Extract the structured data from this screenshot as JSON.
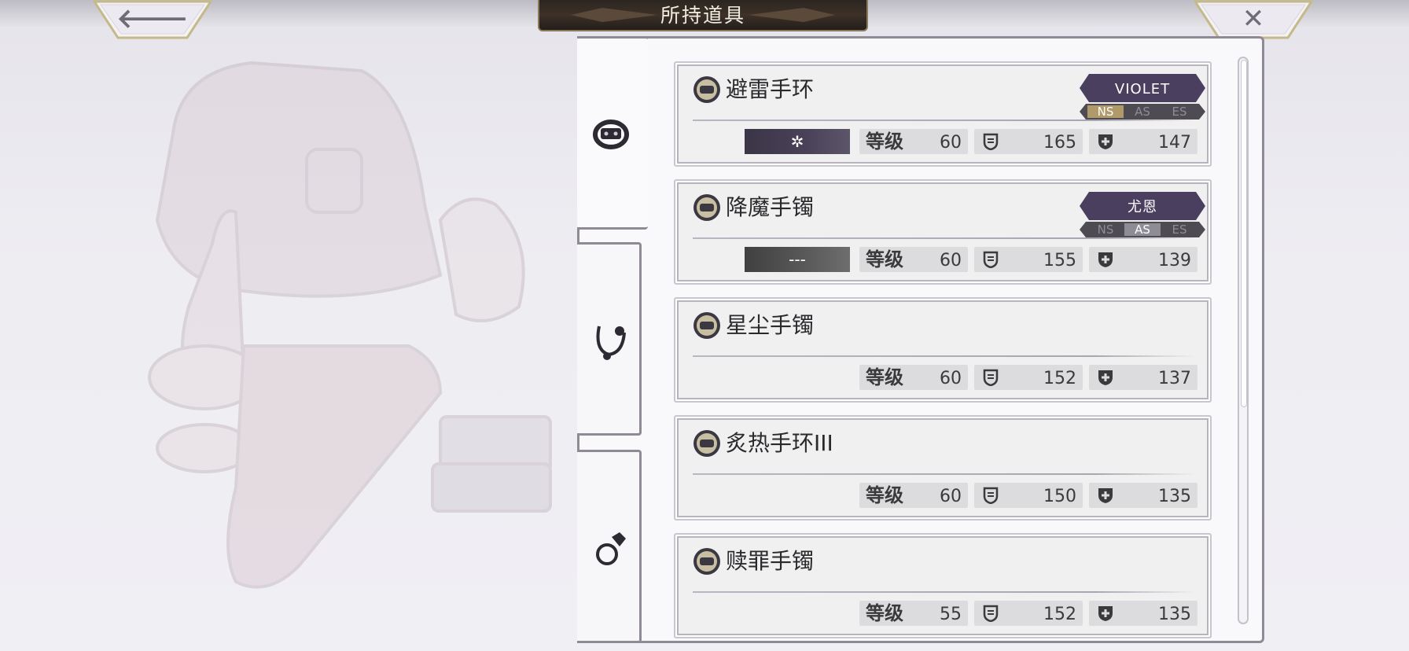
{
  "header": {
    "title": "所持道具",
    "back_icon": "back-arrow-icon",
    "close_icon": "close-icon"
  },
  "tabs": [
    {
      "icon": "bracelet-icon",
      "active": true
    },
    {
      "icon": "necklace-icon",
      "active": false
    },
    {
      "icon": "ring-icon",
      "active": false
    }
  ],
  "stat_labels": {
    "level": "等级",
    "defense_icon": "shield-icon",
    "resist_icon": "plus-shield-icon"
  },
  "items": [
    {
      "name": "避雷手环",
      "owner": "VIOLET",
      "modes": [
        "NS",
        "AS",
        "ES"
      ],
      "active_mode": "NS",
      "element": "✲",
      "level": "60",
      "defense": "165",
      "resist": "147"
    },
    {
      "name": "降魔手镯",
      "owner": "尤恩",
      "modes": [
        "NS",
        "AS",
        "ES"
      ],
      "active_mode": "AS",
      "element": "---",
      "level": "60",
      "defense": "155",
      "resist": "139"
    },
    {
      "name": "星尘手镯",
      "level": "60",
      "defense": "152",
      "resist": "137"
    },
    {
      "name": "炙热手环III",
      "level": "60",
      "defense": "150",
      "resist": "135"
    },
    {
      "name": "赎罪手镯",
      "level": "55",
      "defense": "152",
      "resist": "135"
    }
  ],
  "colors": {
    "owner_tag": "#4b3f60",
    "active_mode": "#b09a6a",
    "title_plate": "#2e2722"
  }
}
